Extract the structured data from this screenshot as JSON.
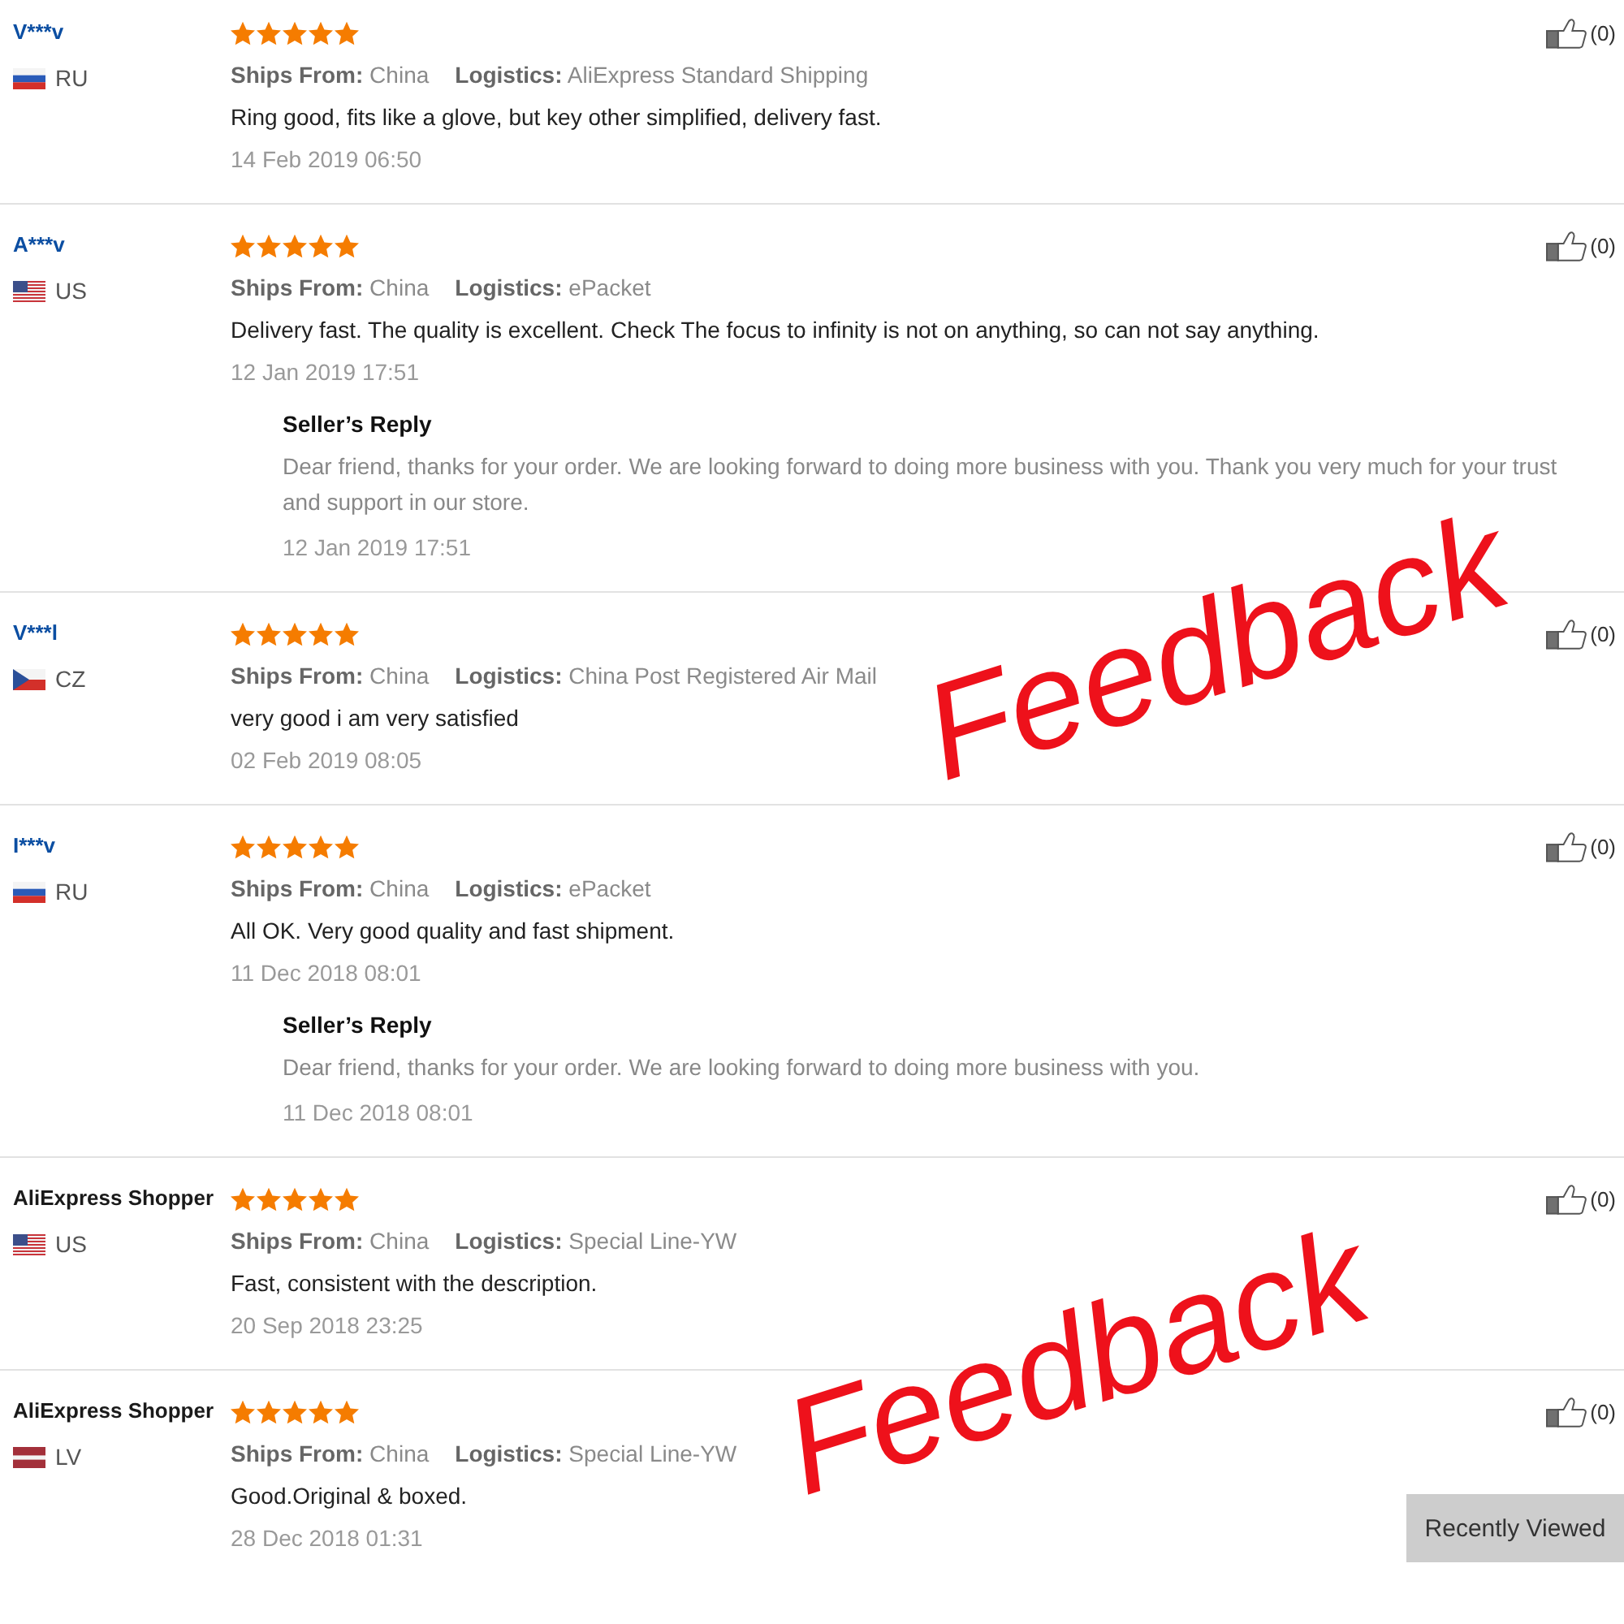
{
  "reviews": [
    {
      "buyer": {
        "name": "V***v",
        "kind": "member",
        "flag": {
          "kind": "ru"
        },
        "country": "RU"
      },
      "stars": 5,
      "ships_from": "**Ships From:** China",
      "logistics": "**Logistics:** AliExpress Standard Shipping",
      "text": "Ring good, fits like a glove, but key other simplified, delivery fast.",
      "date": "14 Feb 2019 06:50",
      "likes": "(0)"
    },
    {
      "buyer": {
        "name": "A***v",
        "kind": "member",
        "flag": {
          "kind": "us"
        },
        "country": "US"
      },
      "stars": 5,
      "ships_from": "**Ships From:** China",
      "logistics": "**Logistics:** ePacket",
      "text": "Delivery fast. The quality is excellent. Check The focus to infinity is not on anything, so can not say anything.",
      "date": "12 Jan 2019 17:51",
      "likes": "(0)",
      "seller_reply": {
        "title": "Seller’s Reply",
        "text": "Dear friend, thanks for your order. We are looking forward to doing more business with you. Thank you very much for your trust and support in our store.",
        "date": "12 Jan 2019 17:51"
      }
    },
    {
      "buyer": {
        "name": "V***l",
        "kind": "member",
        "flag": {
          "kind": "cz"
        },
        "country": "CZ"
      },
      "stars": 5,
      "ships_from": "**Ships From:** China",
      "logistics": "**Logistics:** China Post Registered Air Mail",
      "text": "very good i am very satisfied",
      "date": "02 Feb 2019 08:05",
      "likes": "(0)"
    },
    {
      "buyer": {
        "name": "I***v",
        "kind": "member",
        "flag": {
          "kind": "ru"
        },
        "country": "RU"
      },
      "stars": 5,
      "ships_from": "**Ships From:** China",
      "logistics": "**Logistics:** ePacket",
      "text": "All OK. Very good quality and fast shipment.",
      "date": "11 Dec 2018 08:01",
      "likes": "(0)",
      "seller_reply": {
        "title": "Seller’s Reply",
        "text": "Dear friend, thanks for your order. We are looking forward to doing more business with you.",
        "date": "11 Dec 2018 08:01"
      }
    },
    {
      "buyer": {
        "name": "AliExpress Shopper",
        "kind": "anonymous",
        "flag": {
          "kind": "us"
        },
        "country": "US"
      },
      "stars": 5,
      "ships_from": "**Ships From:** China",
      "logistics": "**Logistics:** Special Line-YW",
      "text": "Fast, consistent with the description.",
      "date": "20 Sep 2018 23:25",
      "likes": "(0)"
    },
    {
      "buyer": {
        "name": "AliExpress Shopper",
        "kind": "anonymous",
        "flag": {
          "kind": "lv"
        },
        "country": "LV"
      },
      "stars": 5,
      "ships_from": "**Ships From:** China",
      "logistics": "**Logistics:** Special Line-YW",
      "text": "Good.Original & boxed.",
      "date": "28 Dec 2018 01:31",
      "likes": "(0)"
    }
  ],
  "overlay_labels": [
    "Feedback",
    "Feedback"
  ],
  "recently_viewed": "Recently Viewed"
}
